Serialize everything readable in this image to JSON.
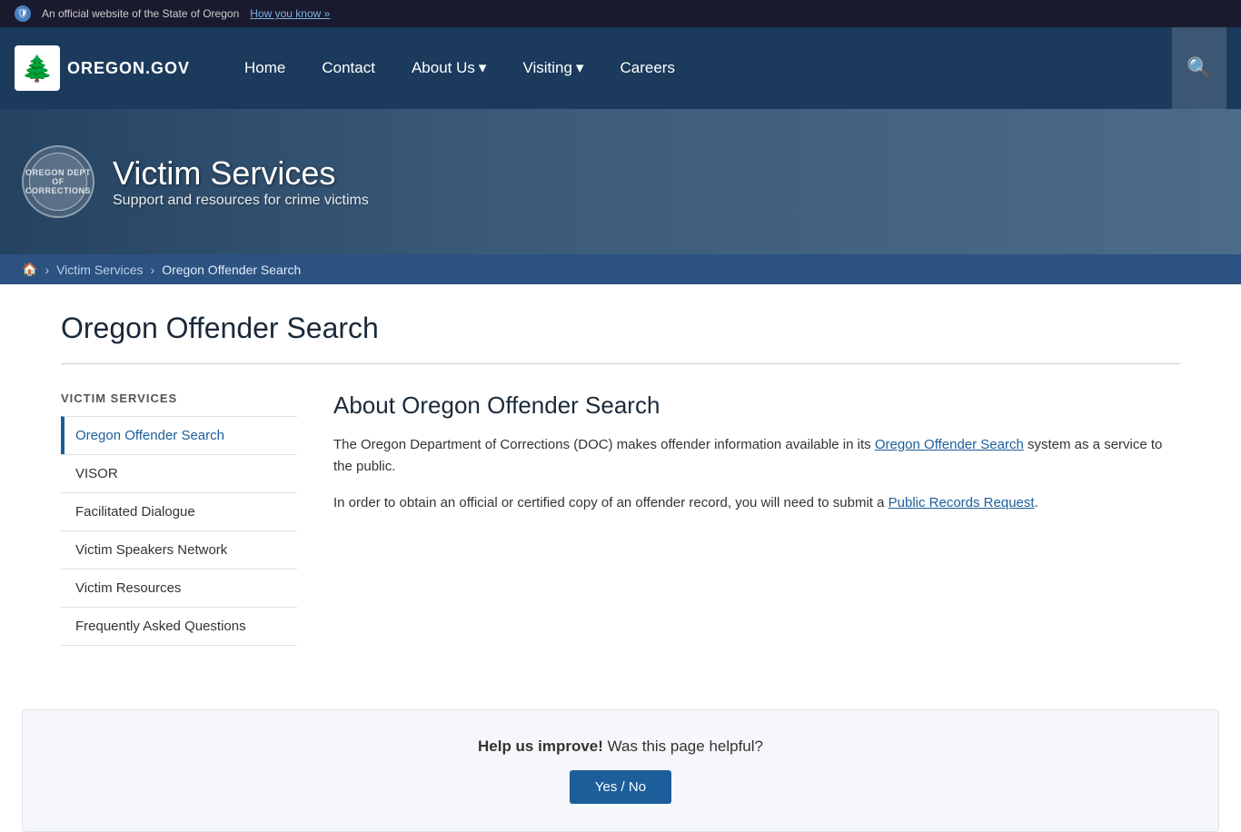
{
  "topbar": {
    "official_text": "An official website of the State of Oregon",
    "how_you_know": "How you know »"
  },
  "nav": {
    "logo_text": "OREGON.GOV",
    "items": [
      {
        "label": "Home",
        "has_dropdown": false
      },
      {
        "label": "Contact",
        "has_dropdown": false
      },
      {
        "label": "About Us",
        "has_dropdown": true
      },
      {
        "label": "Visiting",
        "has_dropdown": true
      },
      {
        "label": "Careers",
        "has_dropdown": false
      }
    ]
  },
  "hero": {
    "badge_text": "OREGON DEPT OF CORRECTIONS",
    "title": "Victim Services",
    "subtitle": "Support and resources for crime victims"
  },
  "breadcrumb": {
    "home_label": "🏠",
    "parent": "Victim Services",
    "current": "Oregon Offender Search"
  },
  "page": {
    "title": "Oregon Offender Search"
  },
  "sidebar": {
    "section_title": "VICTIM SERVICES",
    "items": [
      {
        "label": "Oregon Offender Search",
        "active": true
      },
      {
        "label": "VISOR",
        "active": false
      },
      {
        "label": "Facilitated Dialogue",
        "active": false
      },
      {
        "label": "Victim Speakers Network",
        "active": false
      },
      {
        "label": "Victim Resources",
        "active": false
      },
      {
        "label": "Frequently Asked Questions",
        "active": false
      }
    ]
  },
  "article": {
    "heading": "About Oregon Offender Search",
    "para1_prefix": "The Oregon Department of Corrections (DOC) makes offender information available in its ",
    "para1_link_text": "Oregon Offender Search",
    "para1_suffix": " system as a service to the public.",
    "para2_prefix": "In order to obtain an official or certified copy of an offender record, you will need to submit a ",
    "para2_link_text": "Public Records Request",
    "para2_suffix": "."
  },
  "help_box": {
    "text_bold": "Help us improve!",
    "text_regular": " Was this page helpful?",
    "button_label": "Yes / No"
  }
}
